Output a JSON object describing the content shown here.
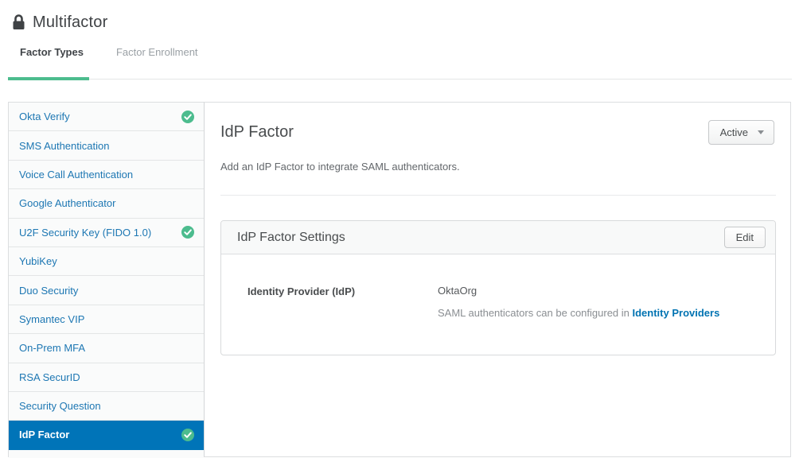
{
  "page": {
    "title": "Multifactor"
  },
  "tabs": [
    {
      "label": "Factor Types",
      "active": true
    },
    {
      "label": "Factor Enrollment",
      "active": false
    }
  ],
  "sidebar": {
    "items": [
      {
        "label": "Okta Verify",
        "check": true,
        "selected": false
      },
      {
        "label": "SMS Authentication",
        "check": false,
        "selected": false
      },
      {
        "label": "Voice Call Authentication",
        "check": false,
        "selected": false
      },
      {
        "label": "Google Authenticator",
        "check": false,
        "selected": false
      },
      {
        "label": "U2F Security Key (FIDO 1.0)",
        "check": true,
        "selected": false
      },
      {
        "label": "YubiKey",
        "check": false,
        "selected": false
      },
      {
        "label": "Duo Security",
        "check": false,
        "selected": false
      },
      {
        "label": "Symantec VIP",
        "check": false,
        "selected": false
      },
      {
        "label": "On-Prem MFA",
        "check": false,
        "selected": false
      },
      {
        "label": "RSA SecurID",
        "check": false,
        "selected": false
      },
      {
        "label": "Security Question",
        "check": false,
        "selected": false
      },
      {
        "label": "IdP Factor",
        "check": true,
        "selected": true
      }
    ]
  },
  "main": {
    "title": "IdP Factor",
    "status_button": {
      "label": "Active"
    },
    "description": "Add an IdP Factor to integrate SAML authenticators.",
    "settings": {
      "title": "IdP Factor Settings",
      "edit_label": "Edit",
      "field_label": "Identity Provider (IdP)",
      "field_value": "OktaOrg",
      "note_prefix": "SAML authenticators can be configured in ",
      "note_link": "Identity Providers"
    }
  },
  "colors": {
    "accent_green": "#4cbc8e",
    "selected_blue": "#0074b8",
    "link_blue": "#1d77b3",
    "note_link_blue": "#0073b2"
  }
}
